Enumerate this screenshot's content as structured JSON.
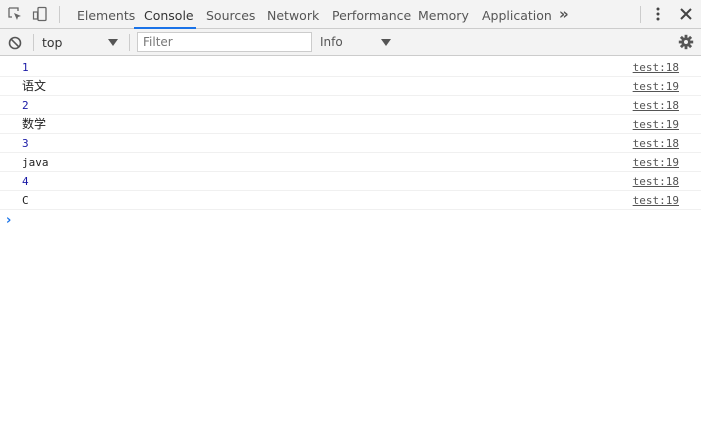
{
  "tabs": [
    {
      "label": "Elements"
    },
    {
      "label": "Console",
      "active": true
    },
    {
      "label": "Sources"
    },
    {
      "label": "Network"
    },
    {
      "label": "Performance"
    },
    {
      "label": "Memory"
    },
    {
      "label": "Application"
    }
  ],
  "more_tabs_glyph": "»",
  "toolbar": {
    "context": "top",
    "filter_placeholder": "Filter",
    "level": "Info"
  },
  "logs": [
    {
      "message": "1",
      "source": "test:18",
      "kind": "number"
    },
    {
      "message": "语文",
      "source": "test:19",
      "kind": "string"
    },
    {
      "message": "2",
      "source": "test:18",
      "kind": "number"
    },
    {
      "message": "数学",
      "source": "test:19",
      "kind": "string"
    },
    {
      "message": "3",
      "source": "test:18",
      "kind": "number"
    },
    {
      "message": "java",
      "source": "test:19",
      "kind": "string"
    },
    {
      "message": "4",
      "source": "test:18",
      "kind": "number"
    },
    {
      "message": "C",
      "source": "test:19",
      "kind": "string"
    }
  ],
  "prompt_glyph": "›",
  "colors": {
    "accent": "#1a73e8",
    "number": "#1a1aa6"
  },
  "icons": [
    "inspect-icon",
    "device-toggle-icon",
    "more-menu-icon",
    "close-icon",
    "clear-console-icon",
    "settings-gear-icon"
  ]
}
